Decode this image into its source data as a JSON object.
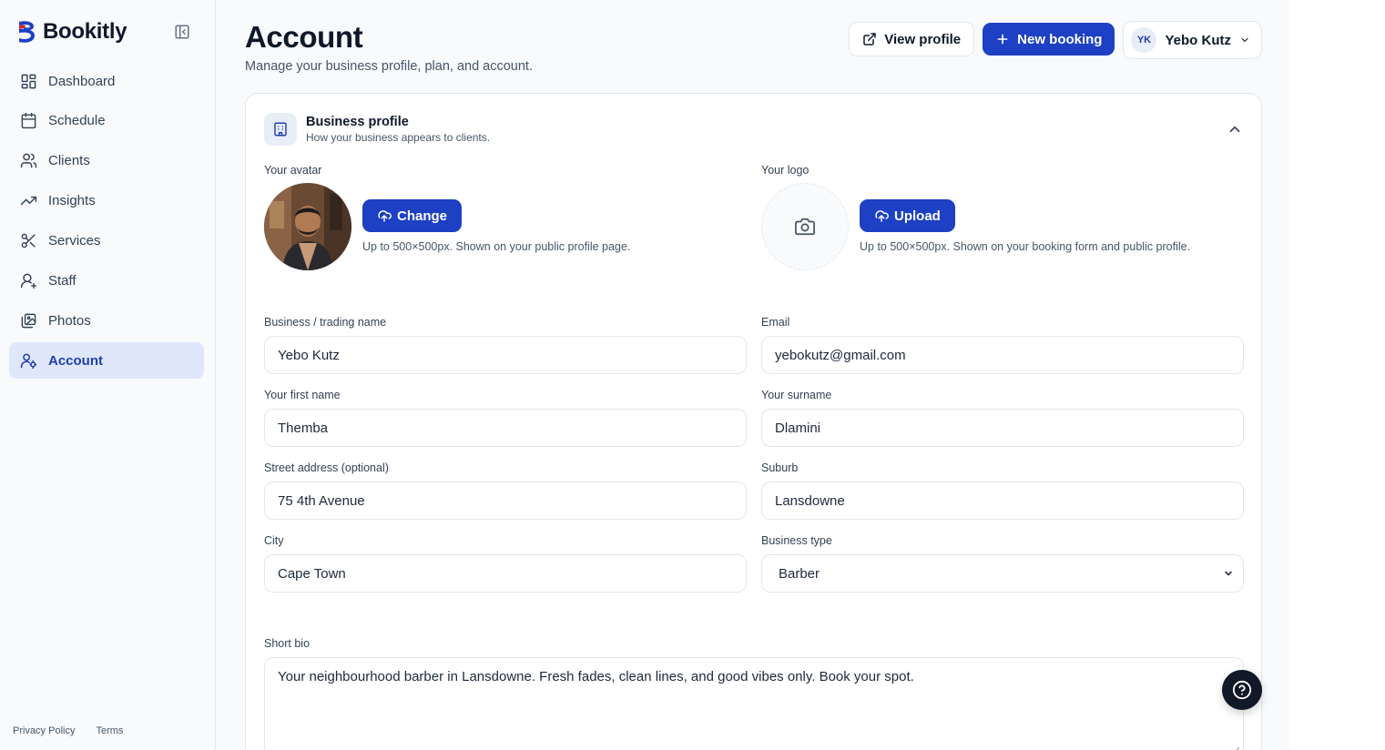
{
  "brand": {
    "name": "Bookitly",
    "accent": "#1d40c4"
  },
  "sidebar": {
    "items": [
      {
        "label": "Dashboard",
        "icon": "dashboard-icon"
      },
      {
        "label": "Schedule",
        "icon": "calendar-icon"
      },
      {
        "label": "Clients",
        "icon": "users-icon"
      },
      {
        "label": "Insights",
        "icon": "trending-up-icon"
      },
      {
        "label": "Services",
        "icon": "scissors-icon"
      },
      {
        "label": "Staff",
        "icon": "staff-icon"
      },
      {
        "label": "Photos",
        "icon": "photos-icon"
      },
      {
        "label": "Account",
        "icon": "account-icon",
        "active": true
      }
    ],
    "footer": {
      "privacy": "Privacy Policy",
      "terms": "Terms"
    }
  },
  "header": {
    "title": "Account",
    "subtitle": "Manage your business profile, plan, and account.",
    "view_profile": "View profile",
    "new_booking": "New booking",
    "user": {
      "initials": "YK",
      "name": "Yebo Kutz"
    }
  },
  "business_profile": {
    "title": "Business profile",
    "subtitle": "How your business appears to clients.",
    "avatar": {
      "label": "Your avatar",
      "button": "Change",
      "hint": "Up to 500×500px. Shown on your public profile page."
    },
    "logo": {
      "label": "Your logo",
      "button": "Upload",
      "hint": "Up to 500×500px. Shown on your booking form and public profile."
    },
    "fields": {
      "business_name": {
        "label": "Business / trading name",
        "value": "Yebo Kutz"
      },
      "email": {
        "label": "Email",
        "value": "yebokutz@gmail.com"
      },
      "first_name": {
        "label": "Your first name",
        "value": "Themba"
      },
      "surname": {
        "label": "Your surname",
        "value": "Dlamini"
      },
      "street": {
        "label": "Street address (optional)",
        "value": "75 4th Avenue"
      },
      "suburb": {
        "label": "Suburb",
        "value": "Lansdowne"
      },
      "city": {
        "label": "City",
        "value": "Cape Town"
      },
      "business_type": {
        "label": "Business type",
        "value": "Barber"
      },
      "bio": {
        "label": "Short bio",
        "value": "Your neighbourhood barber in Lansdowne. Fresh fades, clean lines, and good vibes only. Book your spot."
      }
    }
  }
}
